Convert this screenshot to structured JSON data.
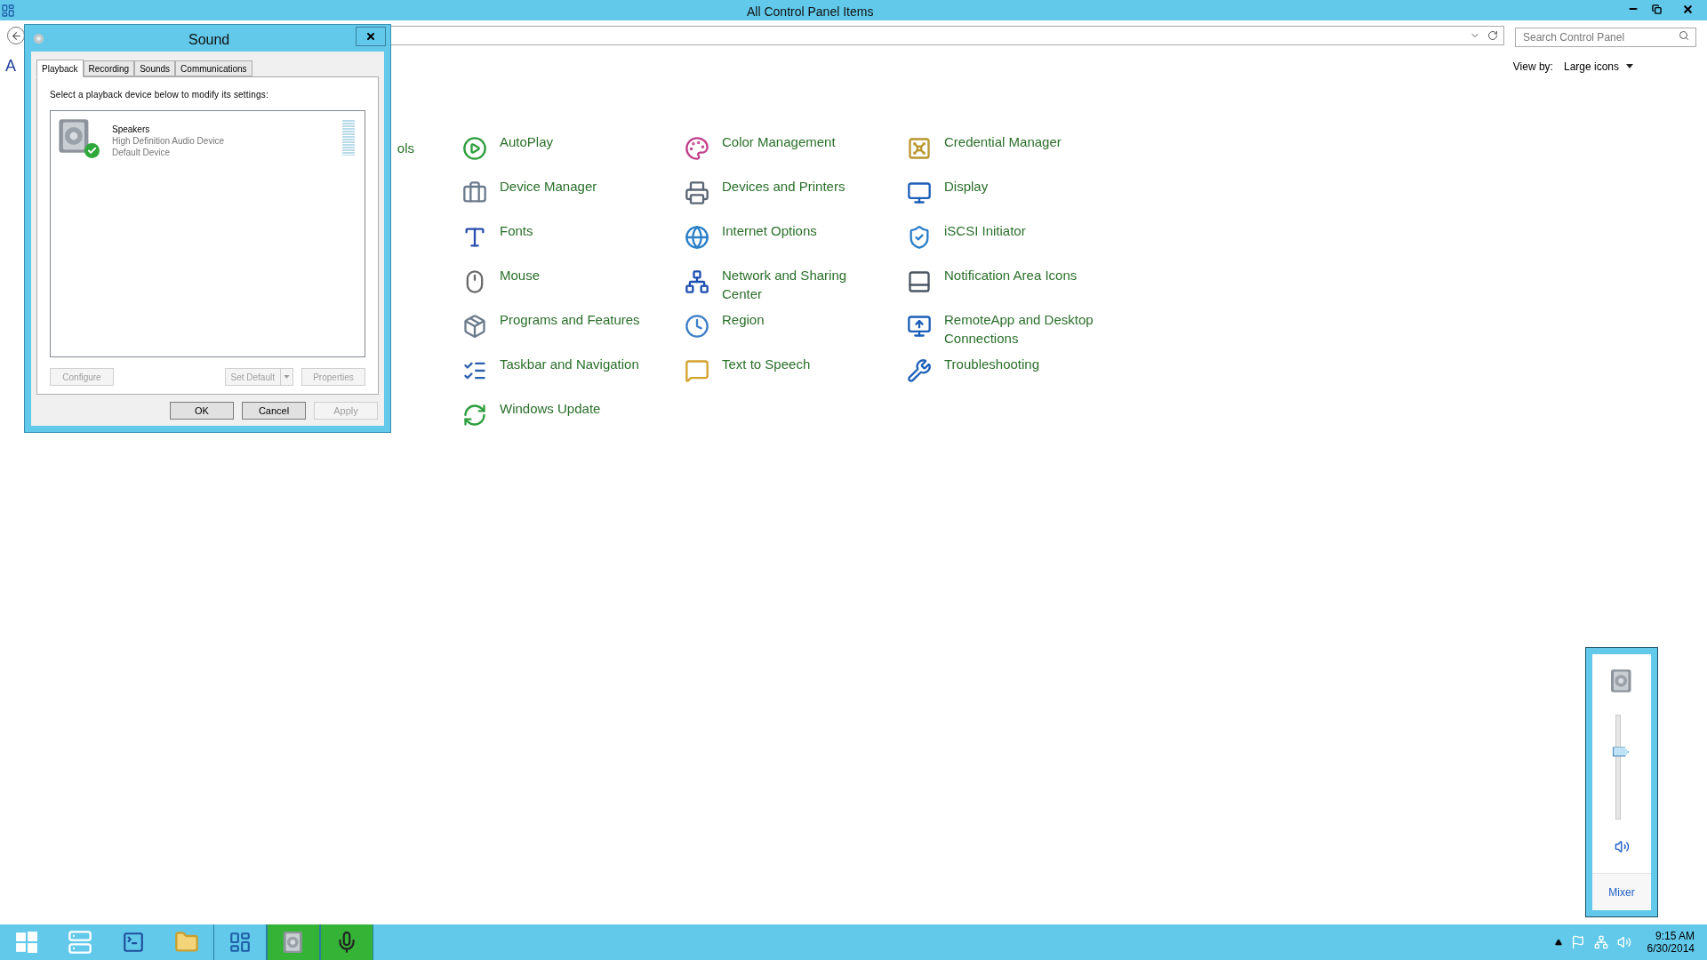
{
  "window": {
    "title": "All Control Panel Items",
    "heading": "A"
  },
  "address_bar": {
    "search_placeholder": "Search Control Panel"
  },
  "view_by": {
    "label": "View by:",
    "value": "Large icons"
  },
  "partial_items": [
    "ols"
  ],
  "items": [
    {
      "label": "AutoPlay"
    },
    {
      "label": "Color Management"
    },
    {
      "label": "Credential Manager"
    },
    {
      "label": "Device Manager"
    },
    {
      "label": "Devices and Printers"
    },
    {
      "label": "Display"
    },
    {
      "label": "Fonts"
    },
    {
      "label": "Internet Options"
    },
    {
      "label": "iSCSI Initiator"
    },
    {
      "label": "Mouse"
    },
    {
      "label": "Network and Sharing Center"
    },
    {
      "label": "Notification Area Icons"
    },
    {
      "label": "Programs and Features"
    },
    {
      "label": "Region"
    },
    {
      "label": "RemoteApp and Desktop Connections"
    },
    {
      "label": "Taskbar and Navigation"
    },
    {
      "label": "Text to Speech"
    },
    {
      "label": "Troubleshooting"
    },
    {
      "label": "Windows Update"
    }
  ],
  "sound_dialog": {
    "title": "Sound",
    "tabs": [
      {
        "label": "Playback",
        "selected": true
      },
      {
        "label": "Recording",
        "selected": false
      },
      {
        "label": "Sounds",
        "selected": false
      },
      {
        "label": "Communications",
        "selected": false
      }
    ],
    "instruction": "Select a playback device below to modify its settings:",
    "devices": [
      {
        "name": "Speakers",
        "description": "High Definition Audio Device",
        "status": "Default Device",
        "default": true,
        "level": 0
      }
    ],
    "device_buttons": [
      {
        "kind": "button",
        "label": "Configure",
        "disabled": true
      },
      {
        "kind": "split",
        "label": "Set Default",
        "disabled": true
      },
      {
        "kind": "button",
        "label": "Properties",
        "disabled": true
      }
    ],
    "buttons": [
      {
        "label": "OK",
        "disabled": false
      },
      {
        "label": "Cancel",
        "disabled": false
      },
      {
        "label": "Apply",
        "disabled": true
      }
    ]
  },
  "volume_flyout": {
    "level": 0.66,
    "muted": false,
    "link": "Mixer"
  },
  "taskbar": {
    "apps": [
      {
        "kind": "start",
        "active": false,
        "open": false
      },
      {
        "kind": "server-manager",
        "active": false,
        "open": false
      },
      {
        "kind": "powershell",
        "active": false,
        "open": false
      },
      {
        "kind": "explorer",
        "active": false,
        "open": false
      },
      {
        "kind": "control-panel",
        "active": false,
        "open": true
      },
      {
        "kind": "sound",
        "active": true,
        "open": true
      },
      {
        "kind": "microphone",
        "active": true,
        "open": true
      }
    ],
    "time": "9:15 AM",
    "date": "6/30/2014"
  }
}
